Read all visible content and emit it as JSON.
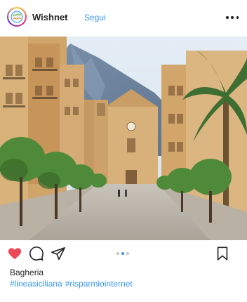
{
  "header": {
    "username": "Wishnet",
    "separator": "•",
    "follow_label": "Segui",
    "avatar_icon": "wishnet-globe-logo",
    "more_icon": "more-options-icon"
  },
  "post": {
    "photo_description_icon": "street-photo",
    "carousel": {
      "total": 3,
      "active": 2
    },
    "actions": {
      "like_icon": "heart-icon",
      "liked": true,
      "comment_icon": "comment-icon",
      "share_icon": "send-icon",
      "save_icon": "bookmark-icon"
    },
    "location": "Bagheria",
    "hashtags": [
      "#lineasiciliana",
      "#risparmiointernet"
    ]
  },
  "colors": {
    "accent": "#3897f0",
    "like": "#ed4956",
    "text": "#262626"
  }
}
